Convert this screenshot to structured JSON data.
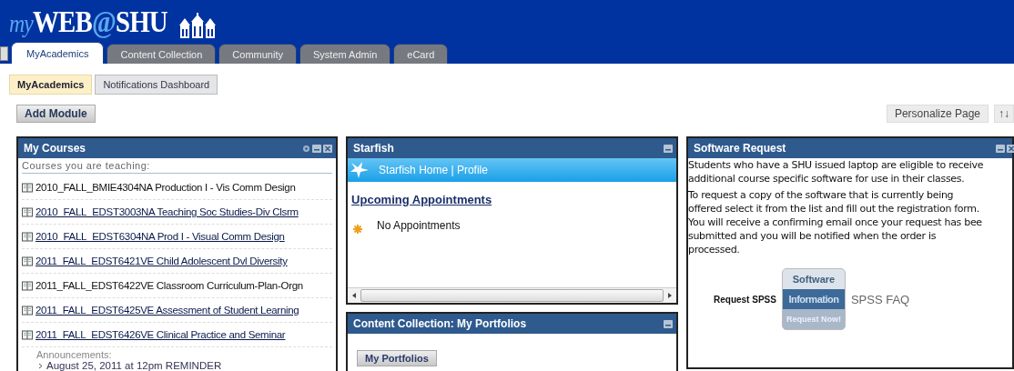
{
  "header": {
    "logo": [
      {
        "text": "my",
        "kind": "script"
      },
      {
        "text": "WEB",
        "kind": "plain"
      },
      {
        "text": "@",
        "kind": "accent"
      },
      {
        "text": "SHU",
        "kind": "plain"
      }
    ]
  },
  "tabs": [
    {
      "label": "MyAcademics",
      "selected": true
    },
    {
      "label": "Content Collection",
      "selected": false
    },
    {
      "label": "Community",
      "selected": false
    },
    {
      "label": "System Admin",
      "selected": false
    },
    {
      "label": "eCard",
      "selected": false
    }
  ],
  "subtabs": [
    {
      "label": "MyAcademics",
      "selected": true
    },
    {
      "label": "Notifications Dashboard",
      "selected": false
    }
  ],
  "toolbar": {
    "add_module": "Add Module",
    "personalize": "Personalize Page",
    "reorder": "↑↓"
  },
  "my_courses": {
    "title": "My Courses",
    "heading": "Courses you are teaching:",
    "courses": [
      {
        "label": "2010_FALL_BMIE4304NA Production I - Vis Comm Design",
        "underlined": false
      },
      {
        "label": "2010_FALL_EDST3003NA Teaching Soc Studies-Div Clsrm",
        "underlined": true
      },
      {
        "label": "2010_FALL_EDST6304NA Prod I - Visual Comm Design",
        "underlined": true
      },
      {
        "label": "2011_FALL_EDST6421VE Child Adolescent Dvl Diversity",
        "underlined": true
      },
      {
        "label": "2011_FALL_EDST6422VE Classroom Curriculum-Plan-Orgn",
        "underlined": false
      },
      {
        "label": "2011_FALL_EDST6425VE Assessment of Student Learning",
        "underlined": true
      },
      {
        "label": "2011_FALL_EDST6426VE Clinical Practice and Seminar",
        "underlined": true
      }
    ],
    "announcements_label": "Announcements:",
    "announcement": "August 25, 2011 at 12pm REMINDER"
  },
  "starfish": {
    "title": "Starfish",
    "nav": "Starfish Home | Profile",
    "section": "Upcoming Appointments",
    "empty": "No Appointments"
  },
  "portfolios": {
    "title": "Content Collection: My Portfolios",
    "button": "My Portfolios"
  },
  "software": {
    "title": "Software Request",
    "paragraphs": [
      [
        "Students who have a SHU issued laptop are eligible to receive",
        "additional course specific software for use in their classes."
      ],
      [
        "To request a copy of the software that is currently being",
        "offered select it from the list and fill out the registration form.",
        "You will receive a confirming email once your request has bee",
        "submitted and you will be notified when the order is",
        "processed."
      ]
    ],
    "request_label": "Request SPSS",
    "badge": {
      "top": "Software",
      "middle": "Information",
      "bottom": "Request Now!"
    },
    "faq": "SPSS FAQ"
  }
}
